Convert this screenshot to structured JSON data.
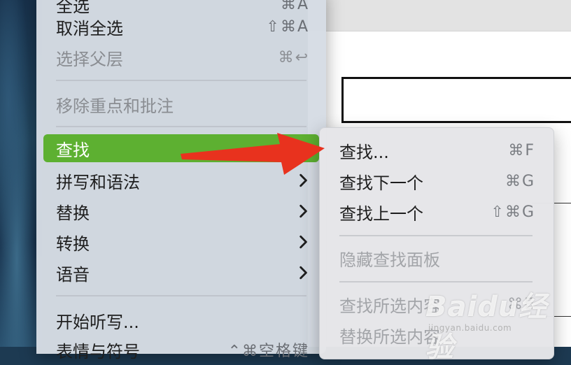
{
  "menu": {
    "items": [
      {
        "label": "全选",
        "shortcut": "⌘A",
        "disabled": false
      },
      {
        "label": "取消全选",
        "shortcut": "⇧⌘A",
        "disabled": false
      },
      {
        "label": "选择父层",
        "shortcut": "⌘↩",
        "disabled": true
      },
      {
        "label": "移除重点和批注",
        "shortcut": "",
        "disabled": true
      },
      {
        "label": "查找",
        "shortcut": "",
        "active": true,
        "submenu": true
      },
      {
        "label": "拼写和语法",
        "submenu": true
      },
      {
        "label": "替换",
        "submenu": true
      },
      {
        "label": "转换",
        "submenu": true
      },
      {
        "label": "语音",
        "submenu": true
      },
      {
        "label": "开始听写...",
        "shortcut": ""
      },
      {
        "label": "表情与符号",
        "shortcut": "⌃⌘空格键"
      }
    ]
  },
  "submenu": {
    "items": [
      {
        "label": "查找...",
        "shortcut": "⌘F",
        "disabled": false
      },
      {
        "label": "查找下一个",
        "shortcut": "⌘G",
        "disabled": false
      },
      {
        "label": "查找上一个",
        "shortcut": "⇧⌘G",
        "disabled": false
      },
      {
        "label": "隐藏查找面板",
        "shortcut": "",
        "disabled": true
      },
      {
        "label": "查找所选内容",
        "shortcut": "⌘E",
        "disabled": true
      },
      {
        "label": "替换所选内容",
        "shortcut": "",
        "disabled": true
      }
    ]
  },
  "colors": {
    "highlight": "#5db031",
    "arrow": "#e8321e"
  },
  "watermark": {
    "main": "Baidu经验",
    "sub": "jingyan.baidu.com"
  }
}
